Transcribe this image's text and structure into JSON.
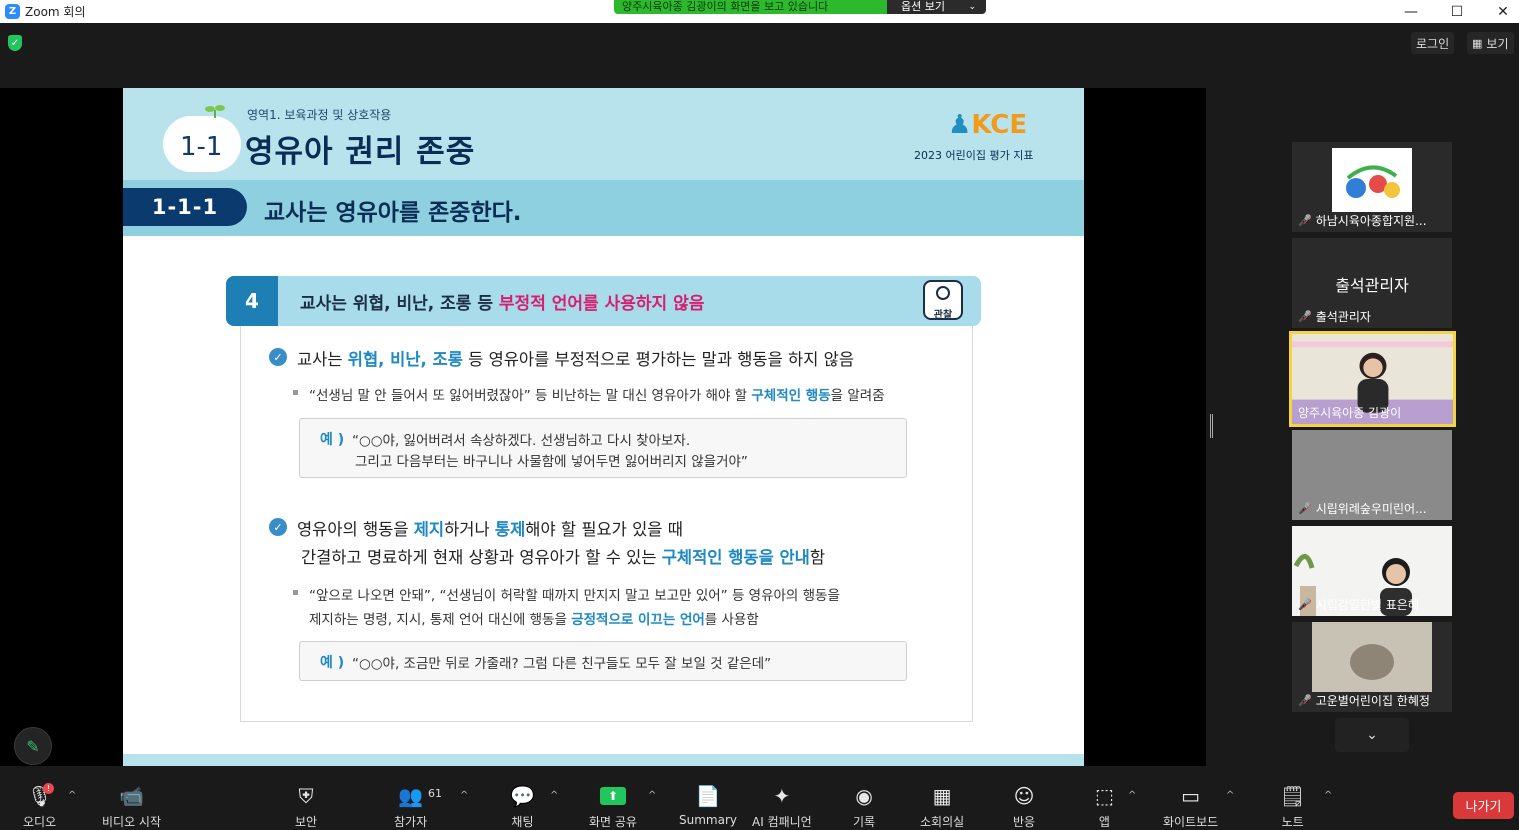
{
  "window": {
    "title": "Zoom 회의",
    "minimize": "—",
    "maximize": "☐",
    "close": "✕"
  },
  "share_banner": {
    "message": "양주시육아종 김광이의 화면을 보고 있습니다",
    "options_label": "옵션 보기",
    "options_chevron": "⌄"
  },
  "topbar": {
    "login": "로그인",
    "view": "보기"
  },
  "slide": {
    "area_label": "영역1. 보육과정 및 상호작용",
    "section_num": "1-1",
    "section_title": "영유아 권리 존중",
    "brand": "KCE",
    "brand_sub": "2023 어린이집 평가 지표",
    "indicator_num": "1-1-1",
    "indicator_text": "교사는 영유아를 존중한다.",
    "item_num": "4",
    "item_text_a": "교사는 위협, 비난, 조롱 등 ",
    "item_text_hl": "부정적 언어를 사용하지 않음",
    "obs_label": "관찰",
    "p1": {
      "a": "교사는 ",
      "b": "위협, 비난, 조롱",
      "c": " 등 영유아를 부정적으로 평가하는 말과 행동을 하지 않음"
    },
    "n1": {
      "a": "“선생님 말 안 들어서 또 잃어버렸잖아” 등 비난하는 말 대신 영유아가 해야 할 ",
      "b": "구체적인 행동",
      "c": "을 알려줌"
    },
    "ex_label": "예 )",
    "ex1_l1": "“○○야, 잃어버려서 속상하겠다. 선생님하고 다시 찾아보자.",
    "ex1_l2": "그리고 다음부터는 바구니나 사물함에 넣어두면 잃어버리지 않을거야”",
    "p2": {
      "a": "영유아의 행동을 ",
      "b": "제지",
      "c": "하거나 ",
      "d": "통제",
      "e": "해야 할 필요가 있을 때"
    },
    "p2b": {
      "a": "간결하고 명료하게 현재 상황과 영유아가 할 수 있는 ",
      "b": "구체적인 행동을 안내",
      "c": "함"
    },
    "n2_l1": "“앞으로 나오면 안돼”, “선생님이 허락할 때까지 만지지 말고 보고만 있어” 등 영유아의 행동을",
    "n2_l2": {
      "a": "제지하는 명령, 지시, 통제 언어 대신에 행동을 ",
      "b": "긍정적으로 이끄는 언어",
      "c": "를 사용함"
    },
    "ex2": "“○○야, 조금만 뒤로 가줄래? 그럼 다른 친구들도 모두 잘 보일 것 같은데”"
  },
  "participants": [
    {
      "name": "하남시육아종합지원...",
      "kind": "logo"
    },
    {
      "name": "출석관리자",
      "big": "출석관리자",
      "kind": "text"
    },
    {
      "name": "양주시육아종 김광이",
      "kind": "active"
    },
    {
      "name": "시립위례숲우미린어...",
      "kind": "blank"
    },
    {
      "name": "시립감일한별 표은혜",
      "kind": "person"
    },
    {
      "name": "고운별어린이집 한혜정",
      "kind": "blur"
    }
  ],
  "more_chevron": "⌄",
  "toolbar": {
    "audio": "오디오",
    "video": "비디오 시작",
    "security": "보안",
    "participants": "참가자",
    "participants_count": "61",
    "chat": "채팅",
    "share": "화면 공유",
    "summary": "Summary",
    "ai": "AI 컴패니언",
    "record": "기록",
    "breakout": "소회의실",
    "reactions": "반응",
    "apps": "앱",
    "whiteboard": "화이트보드",
    "notes": "노트",
    "leave": "나가기",
    "audio_badge": "!"
  },
  "colors": {
    "accent_green": "#22c55e",
    "leave_red": "#d93939",
    "slide_blue": "#1f89c2",
    "highlight_pink": "#d61f73"
  }
}
